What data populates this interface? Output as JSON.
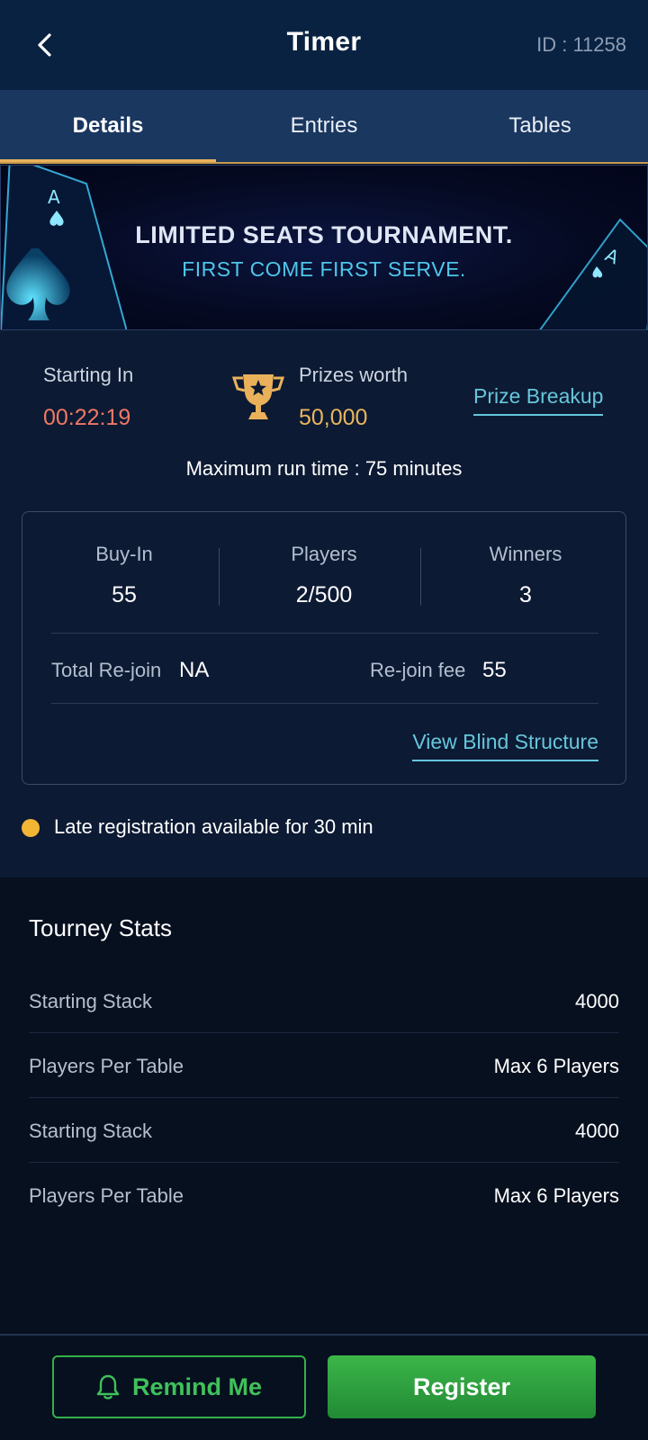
{
  "header": {
    "title": "Timer",
    "id_text": "ID : 11258"
  },
  "tabs": [
    {
      "label": "Details",
      "active": true
    },
    {
      "label": "Entries",
      "active": false
    },
    {
      "label": "Tables",
      "active": false
    }
  ],
  "banner": {
    "line1": "LIMITED SEATS TOURNAMENT.",
    "line2": "FIRST COME FIRST SERVE."
  },
  "summary": {
    "starting_label": "Starting In",
    "starting_value": "00:22:19",
    "prizes_label": "Prizes worth",
    "prizes_value": "50,000",
    "prize_breakup_label": "Prize Breakup",
    "runtime_text": "Maximum run time : 75 minutes"
  },
  "card": {
    "buyin_label": "Buy-In",
    "buyin_value": "55",
    "players_label": "Players",
    "players_value": "2/500",
    "winners_label": "Winners",
    "winners_value": "3",
    "total_rejoin_label": "Total Re-join",
    "total_rejoin_value": "NA",
    "rejoin_fee_label": "Re-join fee",
    "rejoin_fee_value": "55",
    "blind_structure_label": "View Blind Structure"
  },
  "late_registration": "Late registration available for 30 min",
  "tourney_stats": {
    "title": "Tourney Stats",
    "rows": [
      {
        "key": "Starting Stack",
        "value": "4000"
      },
      {
        "key": "Players Per Table",
        "value": "Max 6 Players"
      },
      {
        "key": "Starting Stack",
        "value": "4000"
      },
      {
        "key": "Players Per Table",
        "value": "Max 6 Players"
      }
    ]
  },
  "footer": {
    "remind_label": "Remind Me",
    "register_label": "Register"
  },
  "colors": {
    "header_bg": "#0a2242",
    "tab_bg": "#1a3760",
    "accent_gold": "#e9b25a",
    "timer_red": "#f07865",
    "link_cyan": "#66c6dc",
    "green": "#33b14a"
  }
}
